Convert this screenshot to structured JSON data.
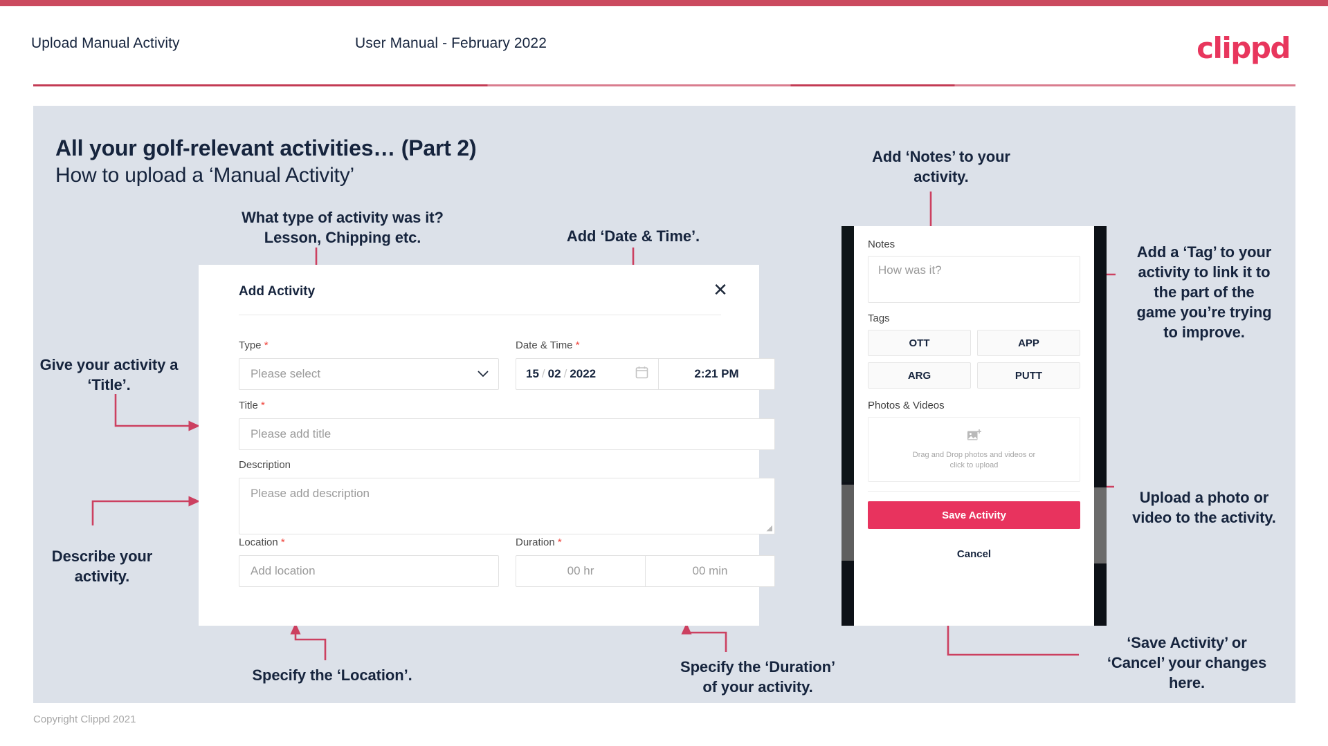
{
  "header": {
    "left_title": "Upload Manual Activity",
    "center_title": "User Manual - February 2022",
    "logo": "clippd"
  },
  "slide": {
    "title": "All your golf-relevant activities… (Part 2)",
    "subtitle": "How to upload a ‘Manual Activity’"
  },
  "dialog": {
    "title": "Add Activity",
    "close_icon": "✕",
    "fields": {
      "type": {
        "label": "Type",
        "required": "*",
        "placeholder": "Please select",
        "chevron": "chevron-down"
      },
      "datetime": {
        "label": "Date & Time",
        "required": "*",
        "day": "15",
        "month": "02",
        "year": "2022",
        "sep": "/",
        "time": "2:21 PM"
      },
      "title": {
        "label": "Title",
        "required": "*",
        "placeholder": "Please add title"
      },
      "description": {
        "label": "Description",
        "required": "",
        "placeholder": "Please add description"
      },
      "location": {
        "label": "Location",
        "required": "*",
        "placeholder": "Add location"
      },
      "duration": {
        "label": "Duration",
        "required": "*",
        "hours": "00 hr",
        "minutes": "00 min"
      }
    }
  },
  "phone": {
    "notes": {
      "label": "Notes",
      "placeholder": "How was it?"
    },
    "tags": {
      "label": "Tags",
      "items": [
        "OTT",
        "APP",
        "ARG",
        "PUTT"
      ]
    },
    "photos": {
      "label": "Photos & Videos",
      "drop_line1": "Drag and Drop photos and videos or",
      "drop_line2": "click to upload",
      "icon": "add-image-icon"
    },
    "save_label": "Save Activity",
    "cancel_label": "Cancel"
  },
  "annotations": {
    "type": "What type of activity was it?\nLesson, Chipping etc.",
    "datetime": "Add ‘Date & Time’.",
    "title": "Give your activity a\n‘Title’.",
    "description": "Describe your\nactivity.",
    "location": "Specify the ‘Location’.",
    "duration": "Specify the ‘Duration’\nof your activity.",
    "notes": "Add ‘Notes’ to your\nactivity.",
    "tags": "Add a ‘Tag’ to your\nactivity to link it to\nthe part of the\ngame you’re trying\nto improve.",
    "upload": "Upload a photo or\nvideo to the activity.",
    "save": "‘Save Activity’ or\n‘Cancel’ your changes\nhere."
  },
  "footer": {
    "copyright": "Copyright Clippd 2021"
  },
  "colors": {
    "brand_pink": "#e8335e",
    "header_rule": "#c33b54",
    "panel_bg": "#dce1e9",
    "ink": "#16243d",
    "arrow": "#cc4060"
  }
}
